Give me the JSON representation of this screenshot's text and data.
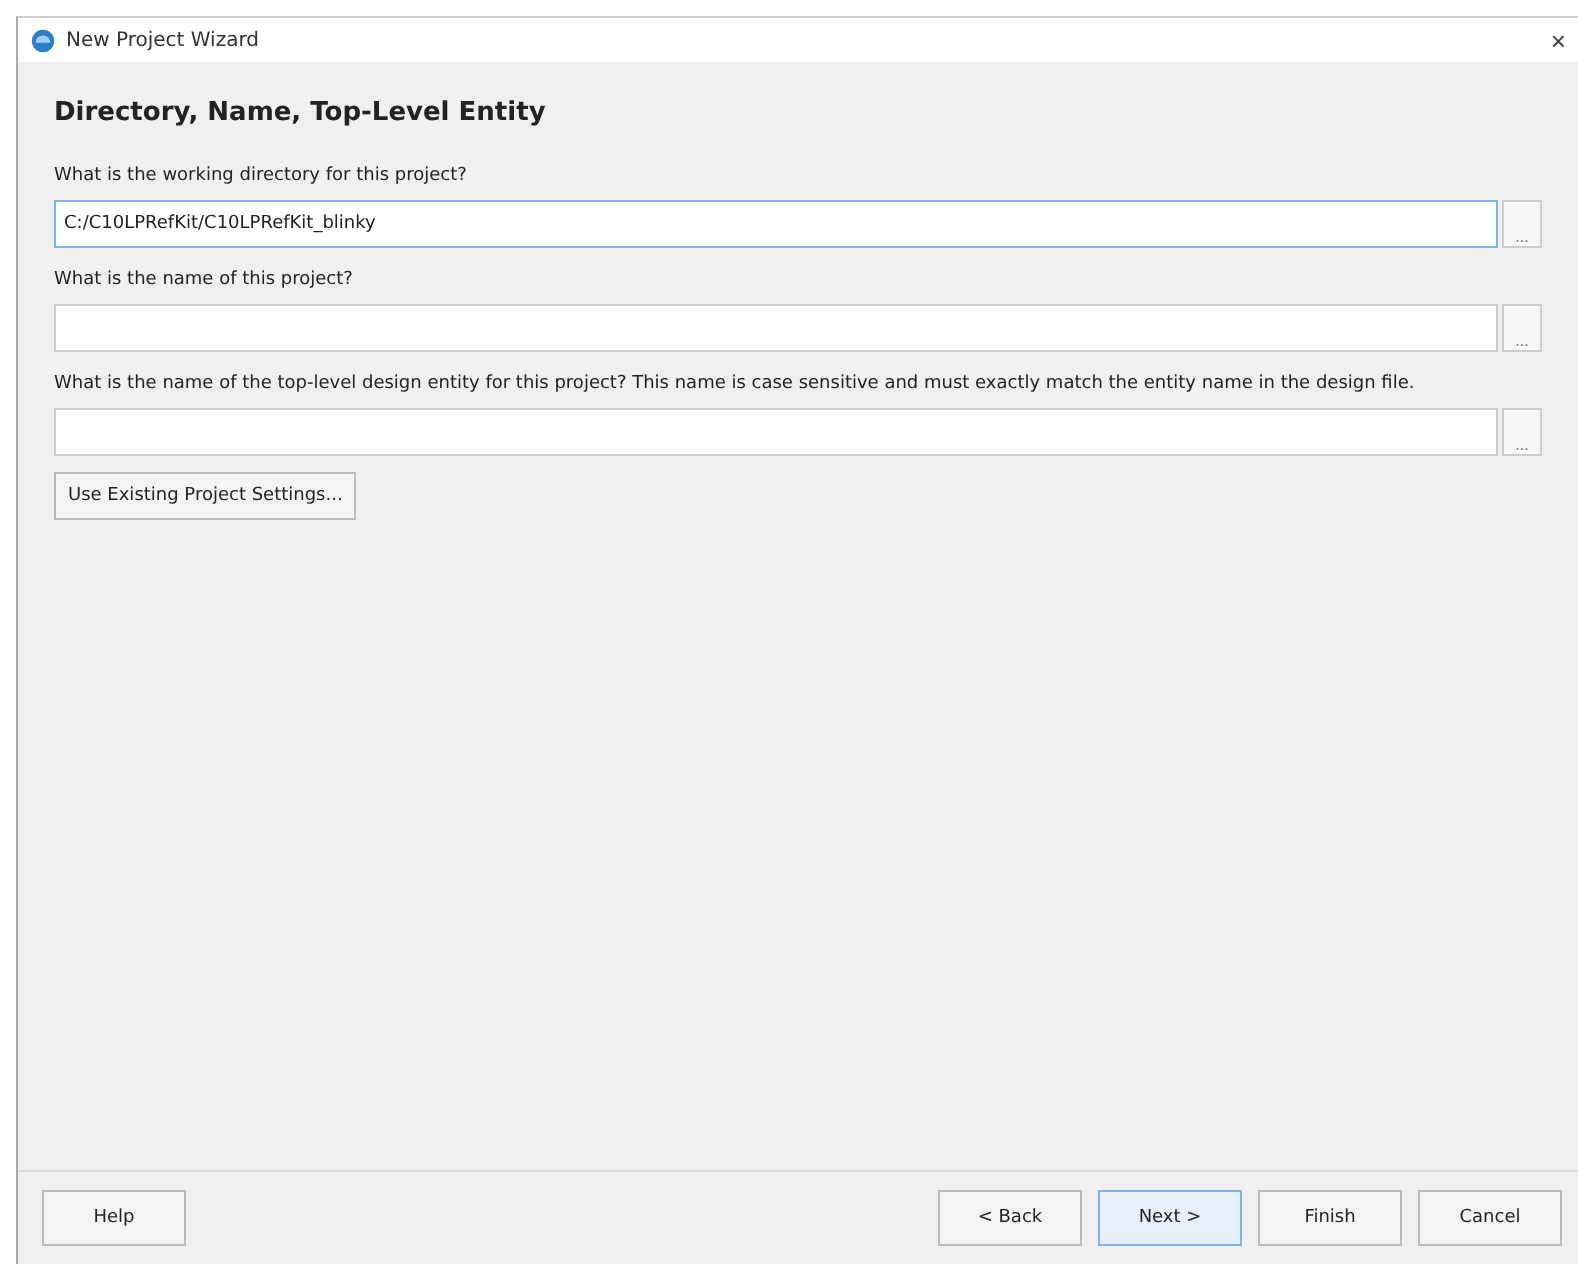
{
  "window": {
    "title": "New Project Wizard",
    "close": "×"
  },
  "heading": "Directory, Name, Top-Level Entity",
  "fields": [
    {
      "label": "What is the working directory for this project?",
      "value": "C:/C10LPRefKit/C10LPRefKit_blinky",
      "browse": "...",
      "focused": true
    },
    {
      "label": "What is the name of this project?",
      "browse": "...",
      "focused": false
    },
    {
      "label": "What is the name of the top-level design entity for this project? This name is case sensitive and must exactly match the entity name in the design file.",
      "browse": "...",
      "focused": false
    }
  ],
  "existing_button": "Use Existing Project Settings...",
  "footer": {
    "help": "Help",
    "buttons": [
      {
        "label": "< Back",
        "selected": false
      },
      {
        "label": "Next >",
        "selected": true
      },
      {
        "label": "Finish",
        "selected": false
      },
      {
        "label": "Cancel",
        "selected": false
      }
    ]
  }
}
